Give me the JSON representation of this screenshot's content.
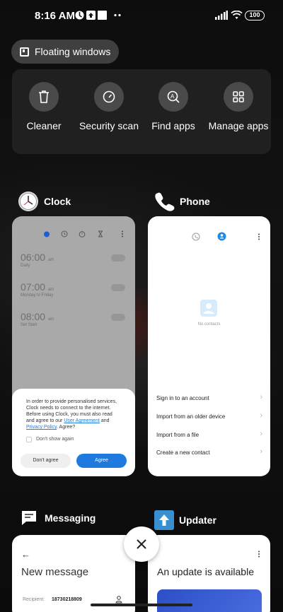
{
  "status": {
    "time": "8:16 AM",
    "battery": "100"
  },
  "floating": {
    "label": "Floating windows"
  },
  "tools": [
    {
      "label": "Cleaner",
      "icon": "trash-icon"
    },
    {
      "label": "Security scan",
      "icon": "speedometer-icon"
    },
    {
      "label": "Find apps",
      "icon": "search-a-icon"
    },
    {
      "label": "Manage apps",
      "icon": "grid-icon"
    }
  ],
  "clock": {
    "title": "Clock",
    "alarms": [
      {
        "time": "06:00",
        "ampm": "am",
        "days": "Daily"
      },
      {
        "time": "07:00",
        "ampm": "am",
        "days": "Monday to Friday"
      },
      {
        "time": "08:00",
        "ampm": "am",
        "days": "Set Start"
      }
    ],
    "dialog": {
      "text_a": "In order to provide personalised services, Clock needs to connect to the internet. Before using Clock, you must also read and agree to our ",
      "link1": "User Agreement",
      "text_b": " and ",
      "link2": "Privacy Policy",
      "text_c": ". Agree?",
      "checkbox": "Don't show again",
      "decline": "Don't agree",
      "accept": "Agree"
    }
  },
  "phone": {
    "title": "Phone",
    "empty": "No contacts",
    "items": [
      "Sign in to an account",
      "Import from an older device",
      "Import from a file",
      "Create a new contact"
    ]
  },
  "messaging": {
    "title": "Messaging",
    "heading": "New message",
    "recipient_label": "Recipient:",
    "recipient": "18730218809"
  },
  "updater": {
    "title": "Updater",
    "heading": "An update is available"
  },
  "colors": {
    "accent": "#1f7ae0",
    "updater_icon": "#3a8fd0"
  }
}
